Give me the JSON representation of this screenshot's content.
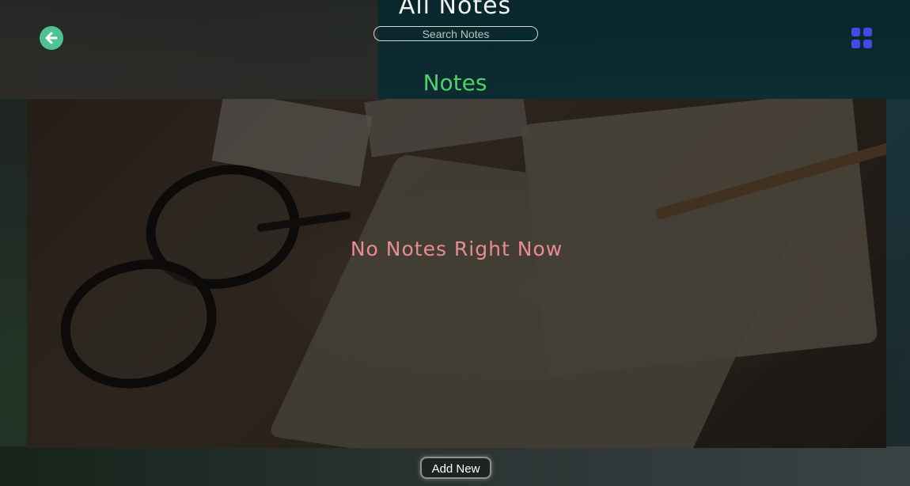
{
  "header": {
    "title": "All Notes",
    "search": {
      "placeholder": "Search Notes",
      "value": ""
    },
    "back_icon": "arrow-left-circle-icon",
    "view_icon": "grid-view-icon"
  },
  "main": {
    "section_title": "Notes",
    "empty_message": "No Notes Right Now"
  },
  "footer": {
    "add_label": "Add New"
  },
  "colors": {
    "title": "#f2f2f2",
    "section_title": "#4fd06a",
    "empty_message": "#e88b92",
    "back_button": "#4ec293",
    "grid_icon": "#4549e8"
  }
}
